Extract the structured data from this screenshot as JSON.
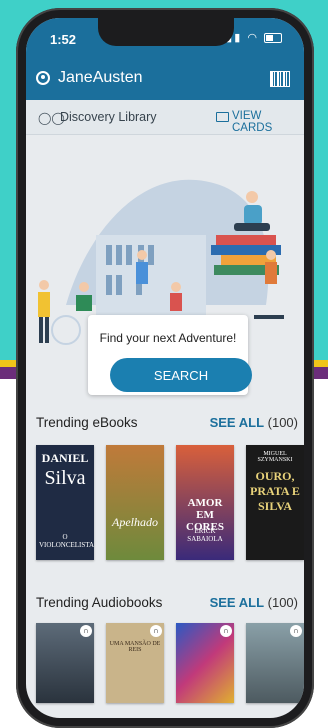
{
  "status": {
    "time": "1:52"
  },
  "appbar": {
    "user_name": "JaneAusten",
    "user_icon": "account-circle-icon",
    "barcode_icon": "barcode-icon"
  },
  "library": {
    "name": "Discovery Library",
    "view_cards_label": "VIEW CARDS"
  },
  "hero": {
    "prompt": "Find your next Adventure!",
    "search_label": "SEARCH"
  },
  "sections": [
    {
      "title": "Trending eBooks",
      "see_all": "SEE ALL",
      "count": "(100)"
    },
    {
      "title": "Trending Audiobooks",
      "see_all": "SEE ALL",
      "count": "(100)"
    }
  ],
  "ebooks": [
    {
      "title_top": "DANIEL",
      "title_main": "Silva",
      "subtitle": "O VIOLONCELISTA",
      "color": "#1f2b44"
    },
    {
      "title_top": "",
      "title_main": "Apelhado",
      "subtitle": "",
      "color": "#a0521d"
    },
    {
      "title_top": "",
      "title_main": "AMOR EM CORES",
      "subtitle": "ERICK SABAIOLA",
      "color": "#c1402b"
    },
    {
      "title_top": "MIGUEL SZYMANSKI",
      "title_main": "OURO, PRATA E SILVA",
      "subtitle": "",
      "color": "#1a1a1a"
    }
  ],
  "audiobooks": [
    {
      "title": "",
      "color": "#3a4654"
    },
    {
      "title": "UMA MANSÃO DE REIS",
      "color": "#c9b48a"
    },
    {
      "title": "",
      "color": "#4b2f6b"
    },
    {
      "title": "",
      "color": "#7d8d95"
    }
  ]
}
